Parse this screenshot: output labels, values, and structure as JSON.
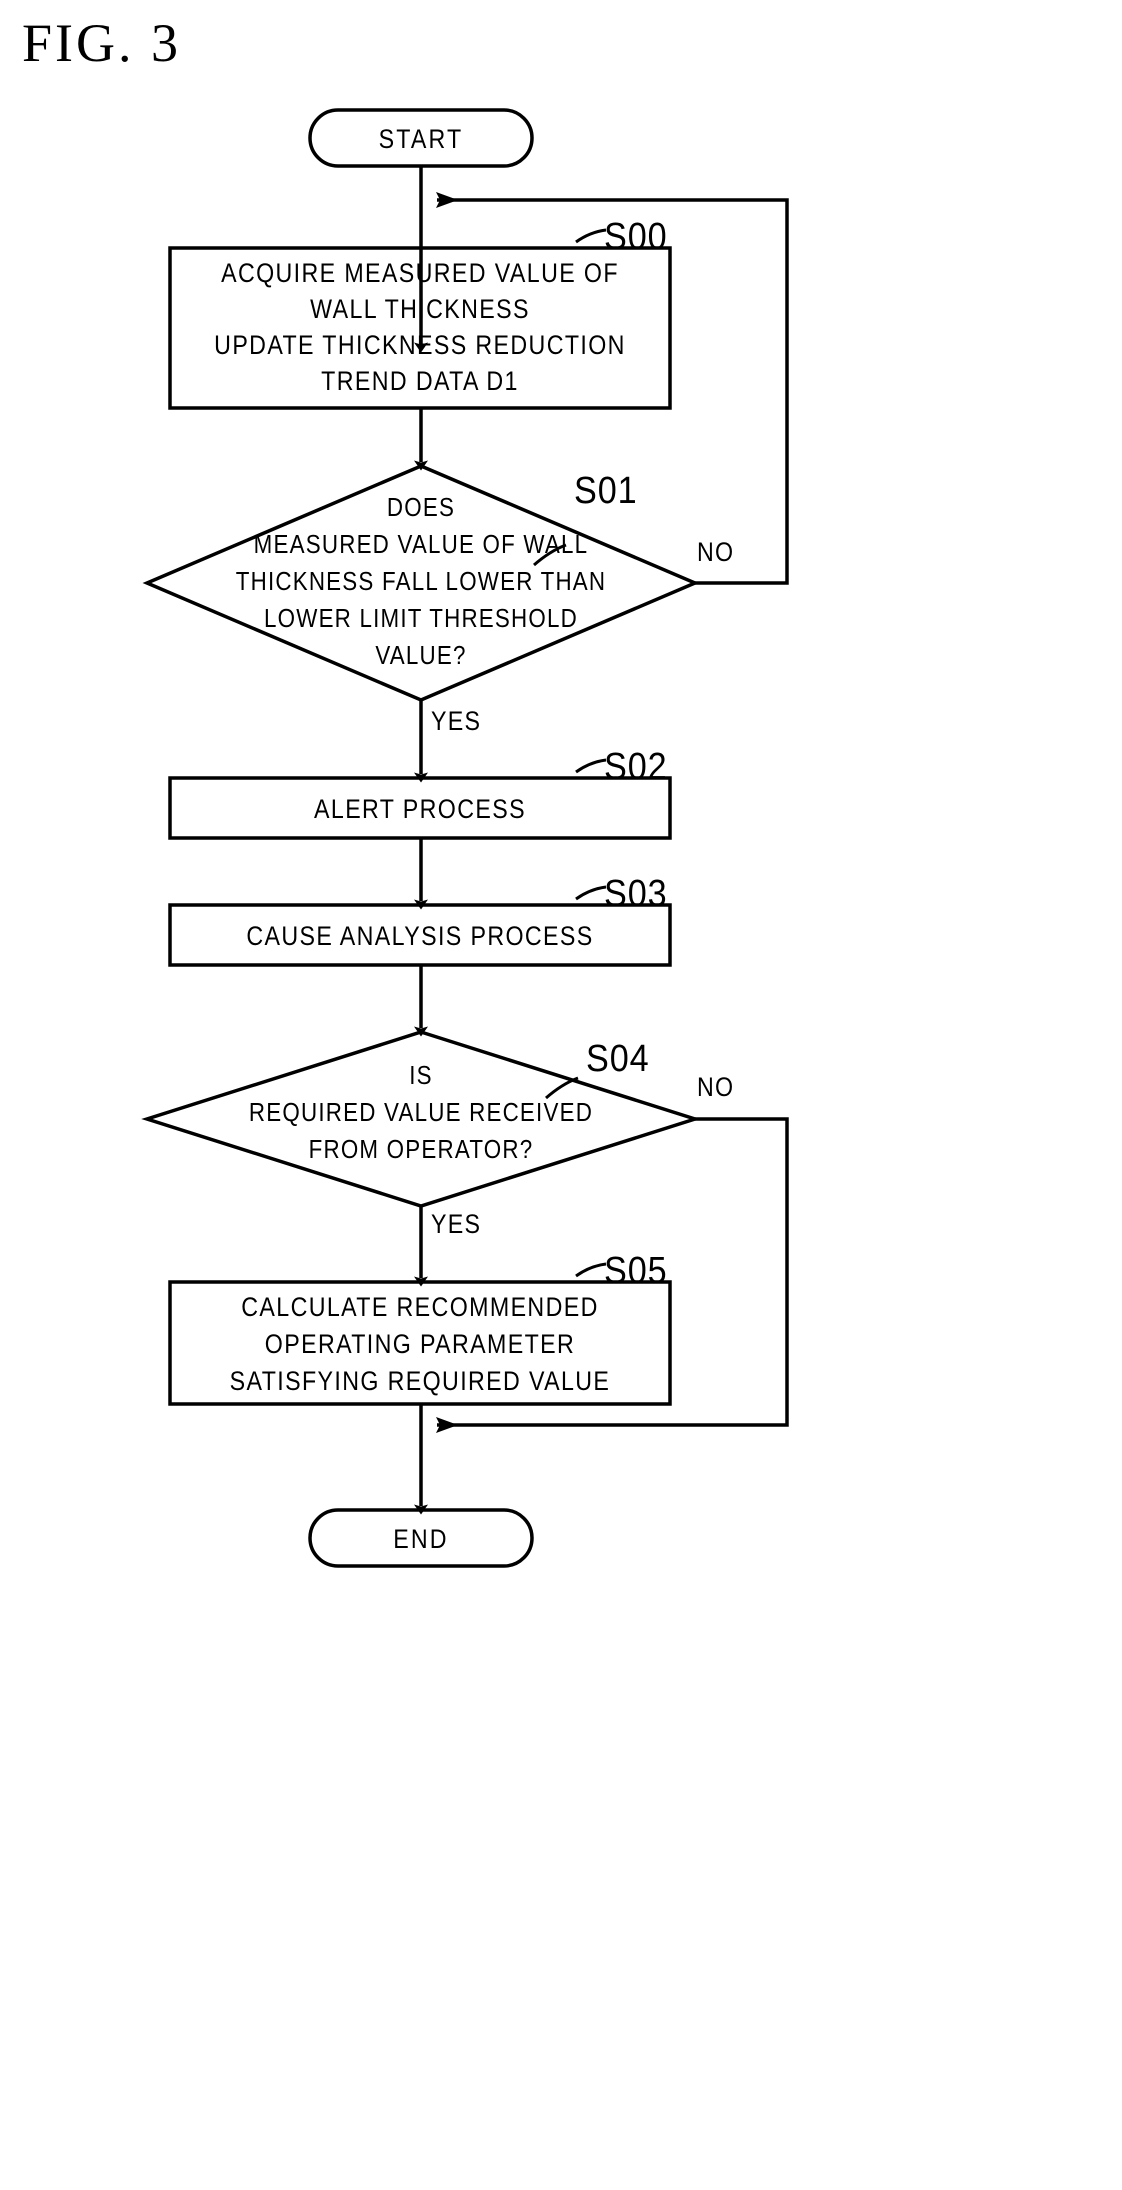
{
  "figure": {
    "title": "FIG. 3",
    "type": "flowchart",
    "line_color": "#000000",
    "background_color": "#ffffff"
  },
  "nodes": {
    "start": {
      "shape": "terminator",
      "label": "START"
    },
    "s00": {
      "shape": "process",
      "step": "S00",
      "lines": [
        "ACQUIRE MEASURED VALUE OF",
        "WALL THICKNESS",
        "UPDATE THICKNESS REDUCTION",
        "TREND DATA D1"
      ]
    },
    "s01": {
      "shape": "decision",
      "step": "S01",
      "lines": [
        "DOES",
        "MEASURED VALUE OF WALL",
        "THICKNESS FALL LOWER THAN",
        "LOWER LIMIT THRESHOLD",
        "VALUE?"
      ],
      "yes_label": "YES",
      "no_label": "NO"
    },
    "s02": {
      "shape": "process",
      "step": "S02",
      "lines": [
        "ALERT PROCESS"
      ]
    },
    "s03": {
      "shape": "process",
      "step": "S03",
      "lines": [
        "CAUSE ANALYSIS PROCESS"
      ]
    },
    "s04": {
      "shape": "decision",
      "step": "S04",
      "lines": [
        "IS",
        "REQUIRED VALUE RECEIVED",
        "FROM OPERATOR?"
      ],
      "yes_label": "YES",
      "no_label": "NO"
    },
    "s05": {
      "shape": "process",
      "step": "S05",
      "lines": [
        "CALCULATE RECOMMENDED",
        "OPERATING PARAMETER",
        "SATISFYING REQUIRED VALUE"
      ]
    },
    "end": {
      "shape": "terminator",
      "label": "END"
    }
  },
  "edges": [
    {
      "from": "start",
      "to": "s00",
      "label": ""
    },
    {
      "from": "s00",
      "to": "s01",
      "label": ""
    },
    {
      "from": "s01",
      "to": "s02",
      "label": "YES"
    },
    {
      "from": "s01",
      "to": "s00",
      "label": "NO"
    },
    {
      "from": "s02",
      "to": "s03",
      "label": ""
    },
    {
      "from": "s03",
      "to": "s04",
      "label": ""
    },
    {
      "from": "s04",
      "to": "s05",
      "label": "YES"
    },
    {
      "from": "s04",
      "to": "end",
      "label": "NO"
    },
    {
      "from": "s05",
      "to": "end",
      "label": ""
    }
  ]
}
